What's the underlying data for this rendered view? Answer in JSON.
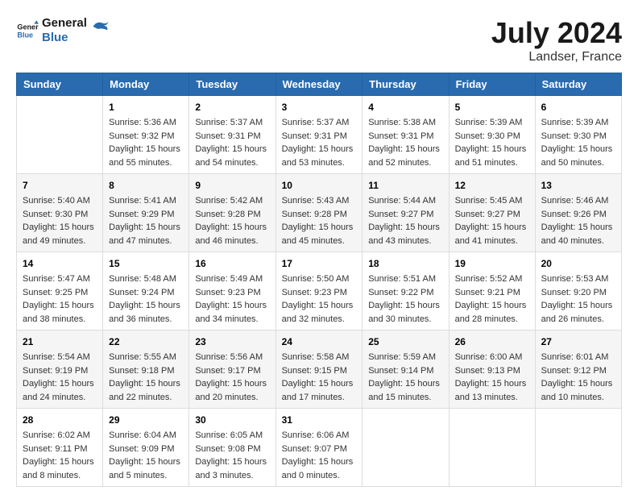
{
  "logo": {
    "text1": "General",
    "text2": "Blue"
  },
  "title": {
    "month_year": "July 2024",
    "location": "Landser, France"
  },
  "headers": [
    "Sunday",
    "Monday",
    "Tuesday",
    "Wednesday",
    "Thursday",
    "Friday",
    "Saturday"
  ],
  "weeks": [
    [
      {
        "day": "",
        "lines": []
      },
      {
        "day": "1",
        "lines": [
          "Sunrise: 5:36 AM",
          "Sunset: 9:32 PM",
          "Daylight: 15 hours",
          "and 55 minutes."
        ]
      },
      {
        "day": "2",
        "lines": [
          "Sunrise: 5:37 AM",
          "Sunset: 9:31 PM",
          "Daylight: 15 hours",
          "and 54 minutes."
        ]
      },
      {
        "day": "3",
        "lines": [
          "Sunrise: 5:37 AM",
          "Sunset: 9:31 PM",
          "Daylight: 15 hours",
          "and 53 minutes."
        ]
      },
      {
        "day": "4",
        "lines": [
          "Sunrise: 5:38 AM",
          "Sunset: 9:31 PM",
          "Daylight: 15 hours",
          "and 52 minutes."
        ]
      },
      {
        "day": "5",
        "lines": [
          "Sunrise: 5:39 AM",
          "Sunset: 9:30 PM",
          "Daylight: 15 hours",
          "and 51 minutes."
        ]
      },
      {
        "day": "6",
        "lines": [
          "Sunrise: 5:39 AM",
          "Sunset: 9:30 PM",
          "Daylight: 15 hours",
          "and 50 minutes."
        ]
      }
    ],
    [
      {
        "day": "7",
        "lines": [
          "Sunrise: 5:40 AM",
          "Sunset: 9:30 PM",
          "Daylight: 15 hours",
          "and 49 minutes."
        ]
      },
      {
        "day": "8",
        "lines": [
          "Sunrise: 5:41 AM",
          "Sunset: 9:29 PM",
          "Daylight: 15 hours",
          "and 47 minutes."
        ]
      },
      {
        "day": "9",
        "lines": [
          "Sunrise: 5:42 AM",
          "Sunset: 9:28 PM",
          "Daylight: 15 hours",
          "and 46 minutes."
        ]
      },
      {
        "day": "10",
        "lines": [
          "Sunrise: 5:43 AM",
          "Sunset: 9:28 PM",
          "Daylight: 15 hours",
          "and 45 minutes."
        ]
      },
      {
        "day": "11",
        "lines": [
          "Sunrise: 5:44 AM",
          "Sunset: 9:27 PM",
          "Daylight: 15 hours",
          "and 43 minutes."
        ]
      },
      {
        "day": "12",
        "lines": [
          "Sunrise: 5:45 AM",
          "Sunset: 9:27 PM",
          "Daylight: 15 hours",
          "and 41 minutes."
        ]
      },
      {
        "day": "13",
        "lines": [
          "Sunrise: 5:46 AM",
          "Sunset: 9:26 PM",
          "Daylight: 15 hours",
          "and 40 minutes."
        ]
      }
    ],
    [
      {
        "day": "14",
        "lines": [
          "Sunrise: 5:47 AM",
          "Sunset: 9:25 PM",
          "Daylight: 15 hours",
          "and 38 minutes."
        ]
      },
      {
        "day": "15",
        "lines": [
          "Sunrise: 5:48 AM",
          "Sunset: 9:24 PM",
          "Daylight: 15 hours",
          "and 36 minutes."
        ]
      },
      {
        "day": "16",
        "lines": [
          "Sunrise: 5:49 AM",
          "Sunset: 9:23 PM",
          "Daylight: 15 hours",
          "and 34 minutes."
        ]
      },
      {
        "day": "17",
        "lines": [
          "Sunrise: 5:50 AM",
          "Sunset: 9:23 PM",
          "Daylight: 15 hours",
          "and 32 minutes."
        ]
      },
      {
        "day": "18",
        "lines": [
          "Sunrise: 5:51 AM",
          "Sunset: 9:22 PM",
          "Daylight: 15 hours",
          "and 30 minutes."
        ]
      },
      {
        "day": "19",
        "lines": [
          "Sunrise: 5:52 AM",
          "Sunset: 9:21 PM",
          "Daylight: 15 hours",
          "and 28 minutes."
        ]
      },
      {
        "day": "20",
        "lines": [
          "Sunrise: 5:53 AM",
          "Sunset: 9:20 PM",
          "Daylight: 15 hours",
          "and 26 minutes."
        ]
      }
    ],
    [
      {
        "day": "21",
        "lines": [
          "Sunrise: 5:54 AM",
          "Sunset: 9:19 PM",
          "Daylight: 15 hours",
          "and 24 minutes."
        ]
      },
      {
        "day": "22",
        "lines": [
          "Sunrise: 5:55 AM",
          "Sunset: 9:18 PM",
          "Daylight: 15 hours",
          "and 22 minutes."
        ]
      },
      {
        "day": "23",
        "lines": [
          "Sunrise: 5:56 AM",
          "Sunset: 9:17 PM",
          "Daylight: 15 hours",
          "and 20 minutes."
        ]
      },
      {
        "day": "24",
        "lines": [
          "Sunrise: 5:58 AM",
          "Sunset: 9:15 PM",
          "Daylight: 15 hours",
          "and 17 minutes."
        ]
      },
      {
        "day": "25",
        "lines": [
          "Sunrise: 5:59 AM",
          "Sunset: 9:14 PM",
          "Daylight: 15 hours",
          "and 15 minutes."
        ]
      },
      {
        "day": "26",
        "lines": [
          "Sunrise: 6:00 AM",
          "Sunset: 9:13 PM",
          "Daylight: 15 hours",
          "and 13 minutes."
        ]
      },
      {
        "day": "27",
        "lines": [
          "Sunrise: 6:01 AM",
          "Sunset: 9:12 PM",
          "Daylight: 15 hours",
          "and 10 minutes."
        ]
      }
    ],
    [
      {
        "day": "28",
        "lines": [
          "Sunrise: 6:02 AM",
          "Sunset: 9:11 PM",
          "Daylight: 15 hours",
          "and 8 minutes."
        ]
      },
      {
        "day": "29",
        "lines": [
          "Sunrise: 6:04 AM",
          "Sunset: 9:09 PM",
          "Daylight: 15 hours",
          "and 5 minutes."
        ]
      },
      {
        "day": "30",
        "lines": [
          "Sunrise: 6:05 AM",
          "Sunset: 9:08 PM",
          "Daylight: 15 hours",
          "and 3 minutes."
        ]
      },
      {
        "day": "31",
        "lines": [
          "Sunrise: 6:06 AM",
          "Sunset: 9:07 PM",
          "Daylight: 15 hours",
          "and 0 minutes."
        ]
      },
      {
        "day": "",
        "lines": []
      },
      {
        "day": "",
        "lines": []
      },
      {
        "day": "",
        "lines": []
      }
    ]
  ]
}
